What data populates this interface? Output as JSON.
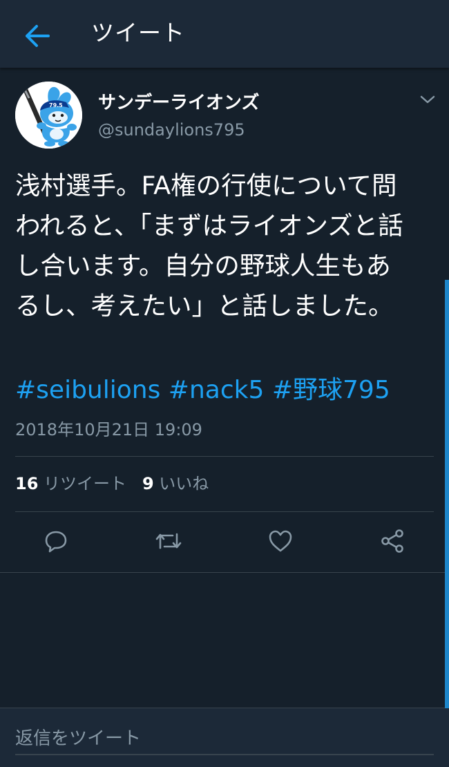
{
  "colors": {
    "background": "#15202b",
    "header_background": "#1c2938",
    "accent": "#1da1f2",
    "secondary_text": "#8899a6",
    "divider": "#38444d"
  },
  "header": {
    "back_icon": "arrow-left-icon",
    "title": "ツイート"
  },
  "tweet": {
    "avatar_icon": "lions-mascot-avatar",
    "avatar_label": "79.5",
    "display_name": "サンデーライオンズ",
    "handle": "@sundaylions795",
    "menu_icon": "chevron-down-icon",
    "text": "浅村選手。FA権の行使について問われると、「まずはライオンズと話し合います。自分の野球人生もあるし、考えたい」と話しました。",
    "hashtags": [
      "#seibulions",
      "#nack5",
      "#野球795"
    ],
    "timestamp": "2018年10月21日 19:09",
    "retweet_count": "16",
    "retweet_label": "リツイート",
    "like_count": "9",
    "like_label": "いいね",
    "actions": [
      "reply-icon",
      "retweet-icon",
      "like-icon",
      "share-icon"
    ]
  },
  "reply": {
    "placeholder": "返信をツイート"
  }
}
